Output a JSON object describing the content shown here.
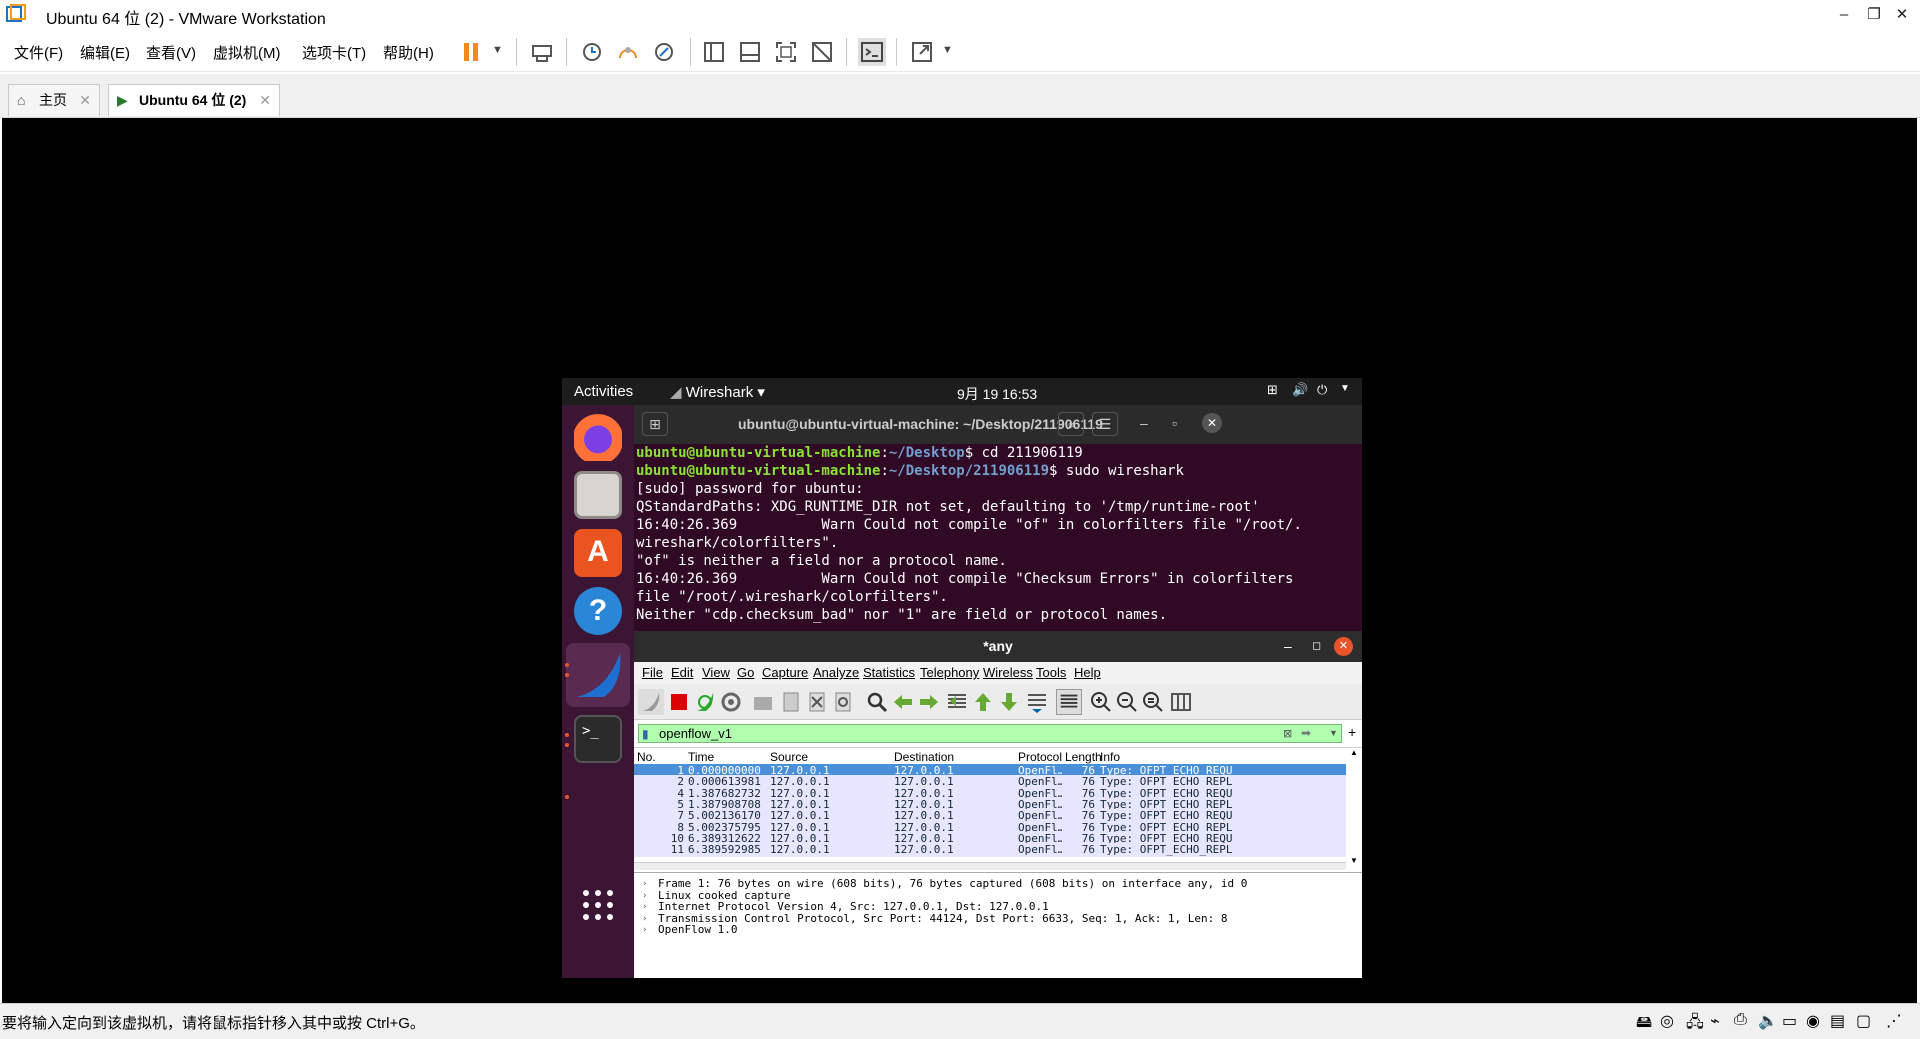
{
  "window": {
    "title": "Ubuntu 64 位 (2) - VMware Workstation",
    "minimize": "–",
    "restore": "❐",
    "close": "✕"
  },
  "menu": {
    "items": [
      "文件(F)",
      "编辑(E)",
      "查看(V)",
      "虚拟机(M)",
      "选项卡(T)",
      "帮助(H)"
    ]
  },
  "tabs": [
    {
      "label": "主页"
    },
    {
      "label": "Ubuntu 64 位 (2)"
    }
  ],
  "status": {
    "text": "要将输入定向到该虚拟机，请将鼠标指针移入其中或按 Ctrl+G。"
  },
  "ubuntu": {
    "activities": "Activities",
    "app_menu": "Wireshark ▾",
    "clock": "9月 19  16:53"
  },
  "terminal": {
    "title": "ubuntu@ubuntu-virtual-machine: ~/Desktop/211906119",
    "lines": [
      {
        "user": "ubuntu@ubuntu-virtual-machine",
        "path": "~/Desktop",
        "cmd": "$ cd 211906119"
      },
      {
        "user": "ubuntu@ubuntu-virtual-machine",
        "path": "~/Desktop/211906119",
        "cmd": "$ sudo wireshark"
      },
      {
        "text": "[sudo] password for ubuntu:"
      },
      {
        "text": "QStandardPaths: XDG_RUNTIME_DIR not set, defaulting to '/tmp/runtime-root'"
      },
      {
        "text": "16:40:26.369          Warn Could not compile \"of\" in colorfilters file \"/root/."
      },
      {
        "text": "wireshark/colorfilters\"."
      },
      {
        "text": "\"of\" is neither a field nor a protocol name."
      },
      {
        "text": "16:40:26.369          Warn Could not compile \"Checksum Errors\" in colorfilters"
      },
      {
        "text": "file \"/root/.wireshark/colorfilters\"."
      },
      {
        "text": "Neither \"cdp.checksum_bad\" nor \"1\" are field or protocol names."
      }
    ]
  },
  "wireshark": {
    "title": "*any",
    "menu": [
      "File",
      "Edit",
      "View",
      "Go",
      "Capture",
      "Analyze",
      "Statistics",
      "Telephony",
      "Wireless",
      "Tools",
      "Help"
    ],
    "filter": "openflow_v1",
    "columns": [
      "No.",
      "Time",
      "Source",
      "Destination",
      "Protocol",
      "Length",
      "Info"
    ],
    "packets": [
      {
        "no": "1",
        "time": "0.000000000",
        "src": "127.0.0.1",
        "dst": "127.0.0.1",
        "proto": "OpenFl…",
        "len": "76",
        "info": "Type: OFPT_ECHO_REQU"
      },
      {
        "no": "2",
        "time": "0.000613981",
        "src": "127.0.0.1",
        "dst": "127.0.0.1",
        "proto": "OpenFl…",
        "len": "76",
        "info": "Type: OFPT_ECHO_REPL"
      },
      {
        "no": "4",
        "time": "1.387682732",
        "src": "127.0.0.1",
        "dst": "127.0.0.1",
        "proto": "OpenFl…",
        "len": "76",
        "info": "Type: OFPT_ECHO_REQU"
      },
      {
        "no": "5",
        "time": "1.387908708",
        "src": "127.0.0.1",
        "dst": "127.0.0.1",
        "proto": "OpenFl…",
        "len": "76",
        "info": "Type: OFPT_ECHO_REPL"
      },
      {
        "no": "7",
        "time": "5.002136170",
        "src": "127.0.0.1",
        "dst": "127.0.0.1",
        "proto": "OpenFl…",
        "len": "76",
        "info": "Type: OFPT_ECHO_REQU"
      },
      {
        "no": "8",
        "time": "5.002375795",
        "src": "127.0.0.1",
        "dst": "127.0.0.1",
        "proto": "OpenFl…",
        "len": "76",
        "info": "Type: OFPT_ECHO_REPL"
      },
      {
        "no": "10",
        "time": "6.389312622",
        "src": "127.0.0.1",
        "dst": "127.0.0.1",
        "proto": "OpenFl…",
        "len": "76",
        "info": "Type: OFPT_ECHO_REQU"
      },
      {
        "no": "11",
        "time": "6.389592985",
        "src": "127.0.0.1",
        "dst": "127.0.0.1",
        "proto": "OpenFl…",
        "len": "76",
        "info": "Type: OFPT_ECHO_REPL"
      }
    ],
    "details": [
      "Frame 1: 76 bytes on wire (608 bits), 76 bytes captured (608 bits) on interface any, id 0",
      "Linux cooked capture",
      "Internet Protocol Version 4, Src: 127.0.0.1, Dst: 127.0.0.1",
      "Transmission Control Protocol, Src Port: 44124, Dst Port: 6633, Seq: 1, Ack: 1, Len: 8",
      "OpenFlow 1.0"
    ]
  },
  "colors": {
    "ubuntu_bg": "#2c001e",
    "dock": "#3b1533",
    "selected_row": "#4a90d9",
    "packet_row": "#e7e6ff",
    "filter_ok": "#afffaf"
  }
}
